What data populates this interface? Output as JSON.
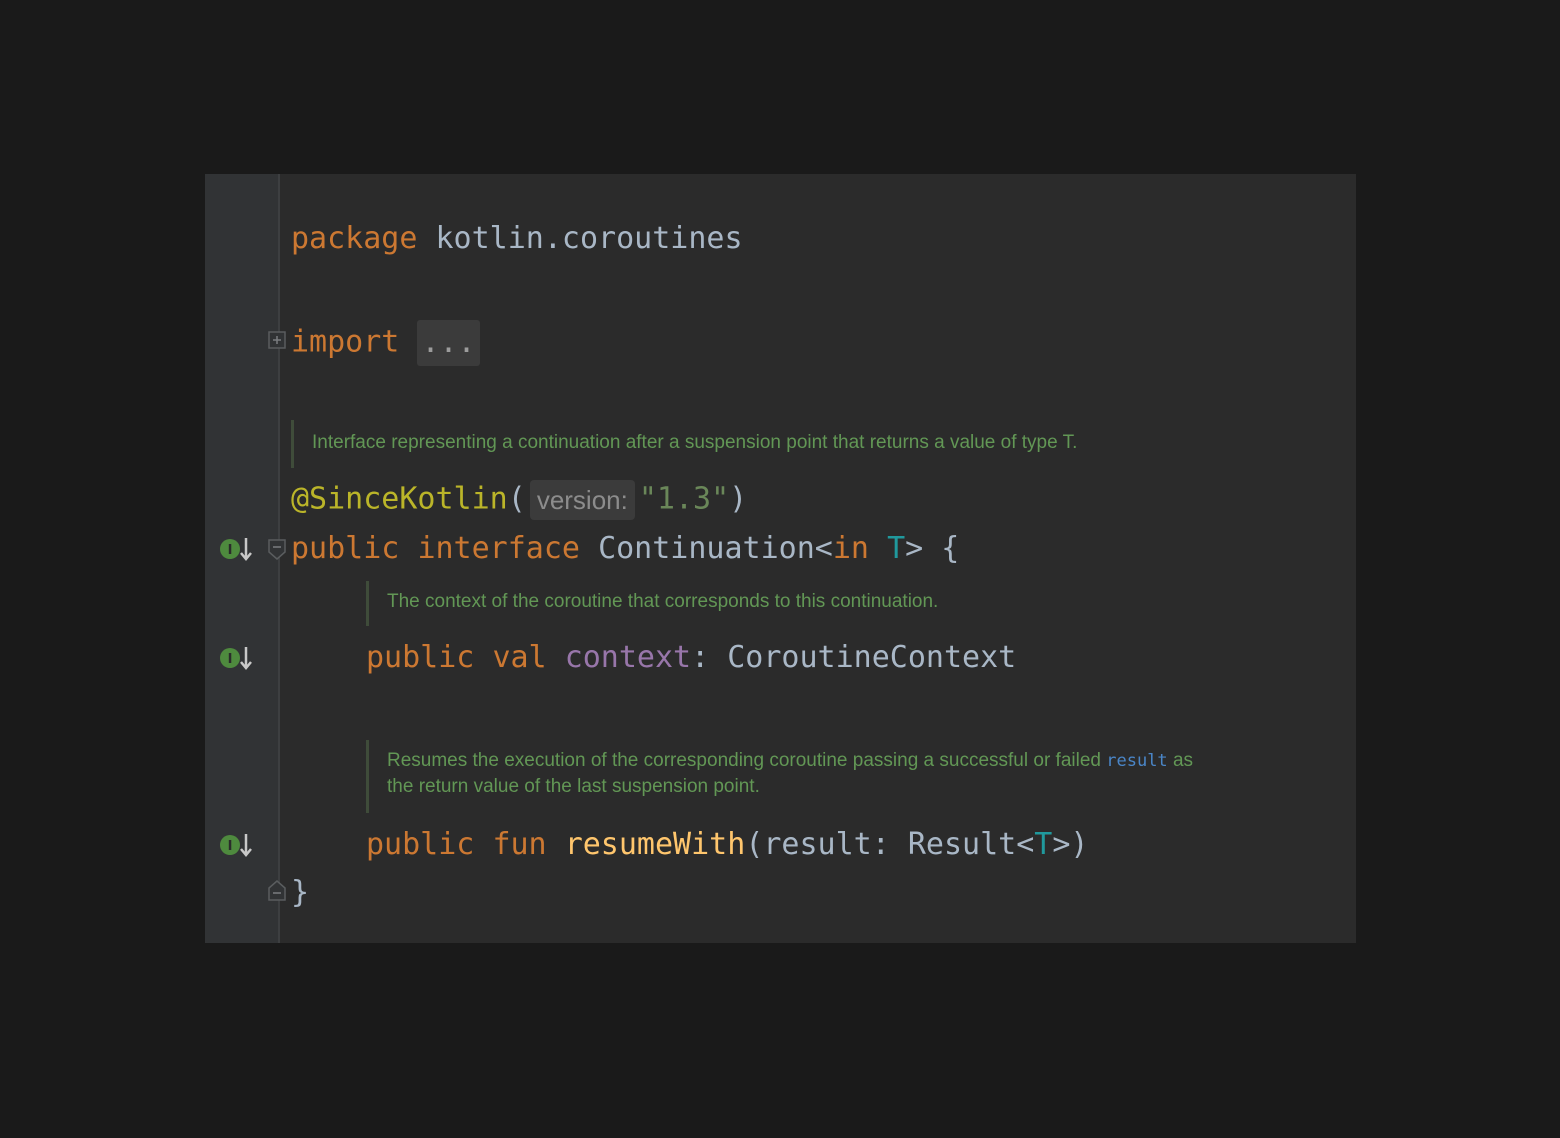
{
  "editor": {
    "package_line": {
      "keyword": "package",
      "name": "kotlin.coroutines"
    },
    "import_line": {
      "keyword": "import",
      "folded": "..."
    },
    "interface_doc": "Interface representing a continuation after a suspension point that returns a value of type T.",
    "annotation": {
      "name": "@SinceKotlin",
      "open": "(",
      "hint": "version:",
      "value": "\"1.3\"",
      "close": ")"
    },
    "interface_decl": {
      "public": "public",
      "interface": "interface",
      "name": "Continuation<",
      "in": "in",
      "type_param": "T",
      "rest": "> {"
    },
    "context_doc": "The context of the coroutine that corresponds to this continuation.",
    "context_decl": {
      "public": "public",
      "val": "val",
      "name": "context",
      "rest": ": CoroutineContext"
    },
    "resume_doc": {
      "text_before": "Resumes the execution of the corresponding coroutine passing a successful or failed ",
      "code": "result",
      "text_after": " as",
      "line2": "the return value of the last suspension point."
    },
    "resume_decl": {
      "public": "public",
      "fun": "fun",
      "name": "resumeWith",
      "params": "(result: Result<",
      "type_param": "T",
      "close": ">)"
    },
    "closing_brace": "}"
  },
  "gutter_icons": [
    "implemented-icon",
    "implemented-icon",
    "implemented-icon"
  ],
  "colors": {
    "background": "#1a1a1a",
    "editor_bg": "#2b2b2b",
    "keyword": "#cc7832",
    "annotation": "#bbb529",
    "string": "#6a8759",
    "type_param": "#20999d",
    "property": "#9876aa",
    "function": "#ffc66d",
    "doc": "#629755",
    "text": "#a9b7c6"
  }
}
